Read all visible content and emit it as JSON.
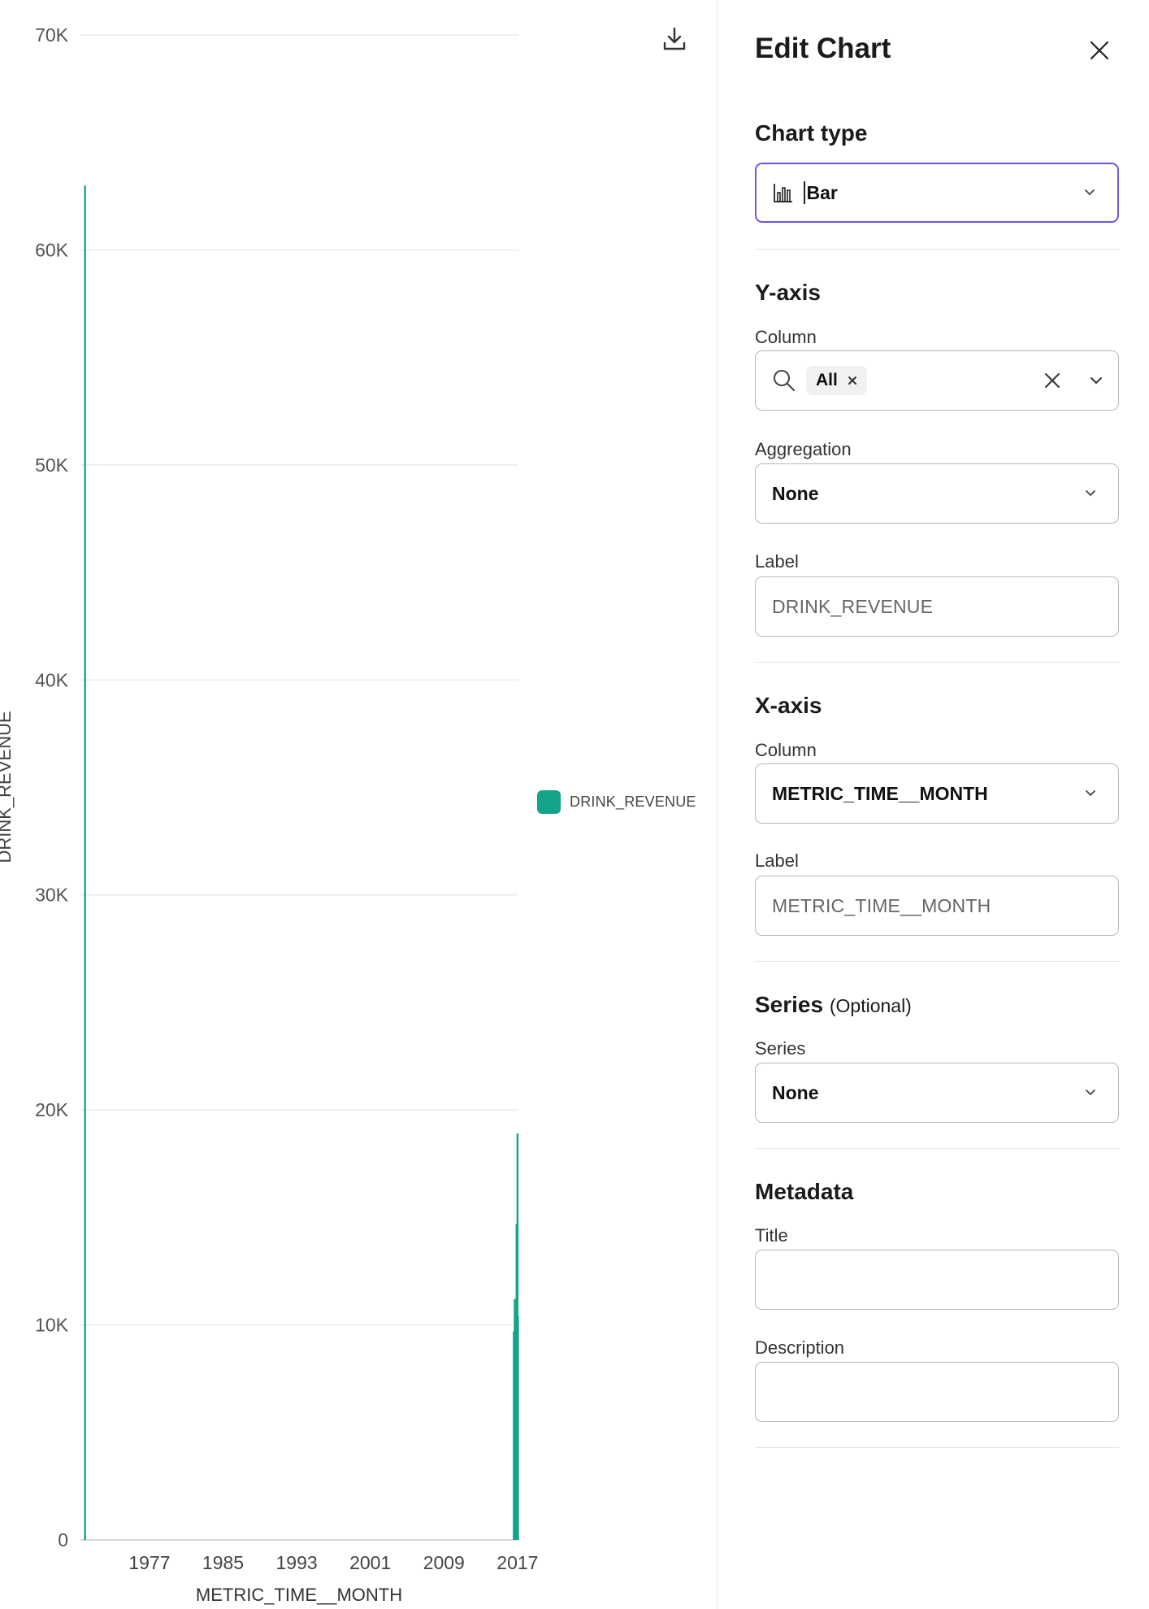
{
  "chart_data": {
    "type": "bar",
    "title": "",
    "xlabel": "METRIC_TIME__MONTH",
    "ylabel": "DRINK_REVENUE",
    "ylim": [
      0,
      70000
    ],
    "yticks": [
      0,
      10000,
      20000,
      30000,
      40000,
      50000,
      60000,
      70000
    ],
    "ytick_labels": [
      "0",
      "10K",
      "20K",
      "30K",
      "40K",
      "50K",
      "60K",
      "70K"
    ],
    "xlim": [
      1969.5,
      2017.1
    ],
    "xticks": [
      1977,
      1985,
      1993,
      2001,
      2009,
      2017
    ],
    "xtick_labels": [
      "1977",
      "1985",
      "1993",
      "2001",
      "2009",
      "2017"
    ],
    "grid": true,
    "legend_position": "right",
    "series": [
      {
        "name": "DRINK_REVENUE",
        "color": "#13a58a",
        "points": [
          {
            "x": 1970.0,
            "y": 63000
          },
          {
            "x": 2016.6,
            "y": 9700
          },
          {
            "x": 2016.7,
            "y": 11200
          },
          {
            "x": 2016.8,
            "y": 10500
          },
          {
            "x": 2016.9,
            "y": 14700
          },
          {
            "x": 2017.0,
            "y": 18900
          },
          {
            "x": 2017.05,
            "y": 10400
          }
        ]
      }
    ]
  },
  "toolbar": {
    "download_icon": "download-icon"
  },
  "legend": {
    "label": "DRINK_REVENUE",
    "color": "#13a58a"
  },
  "panel": {
    "title": "Edit Chart",
    "chart_type": {
      "heading": "Chart type",
      "value": "Bar",
      "icon": "bar-chart-icon"
    },
    "y_axis": {
      "heading": "Y-axis",
      "column_label": "Column",
      "column_chip": "All",
      "aggregation_label": "Aggregation",
      "aggregation_value": "None",
      "label_label": "Label",
      "label_placeholder": "DRINK_REVENUE"
    },
    "x_axis": {
      "heading": "X-axis",
      "column_label": "Column",
      "column_value": "METRIC_TIME__MONTH",
      "label_label": "Label",
      "label_placeholder": "METRIC_TIME__MONTH"
    },
    "series": {
      "heading": "Series",
      "heading_optional": "(Optional)",
      "field_label": "Series",
      "value": "None"
    },
    "metadata": {
      "heading": "Metadata",
      "title_label": "Title",
      "title_value": "",
      "description_label": "Description",
      "description_value": ""
    }
  },
  "colors": {
    "accent": "#6b57e6",
    "series": "#13a58a"
  }
}
